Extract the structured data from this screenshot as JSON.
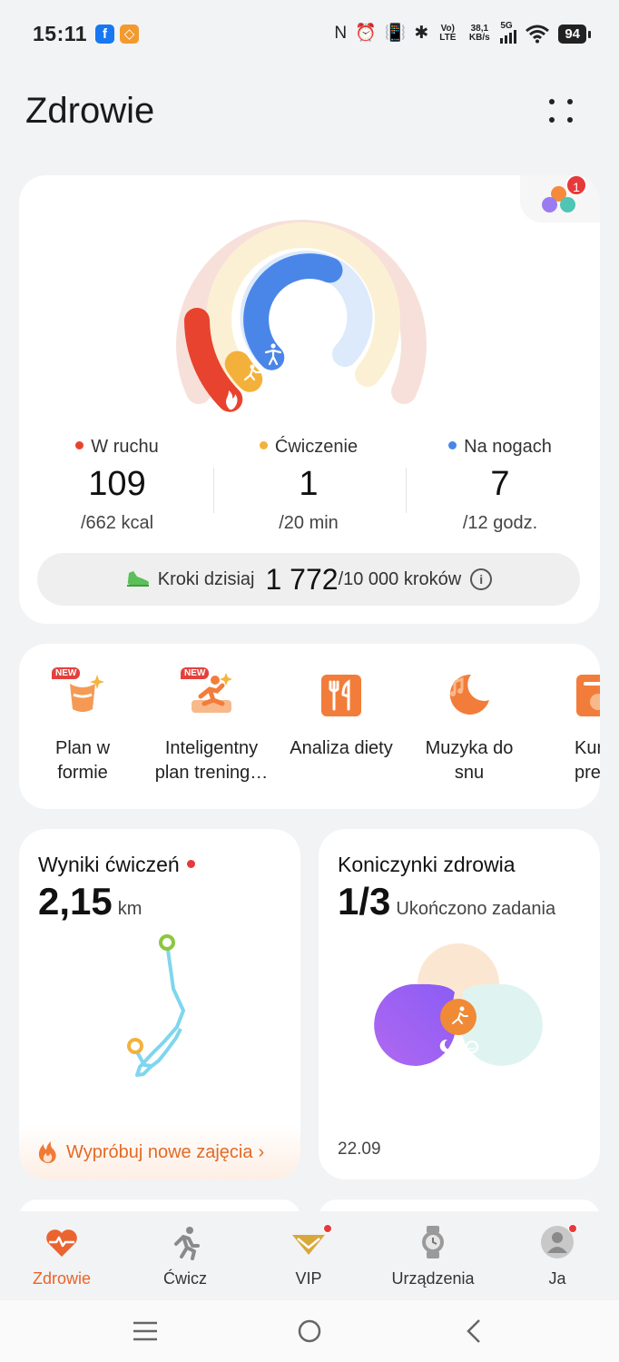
{
  "status_bar": {
    "time": "15:11",
    "volte": "Vo) LTE",
    "speed_value": "38,1",
    "speed_unit": "KB/s",
    "network": "5G",
    "battery": "94"
  },
  "header": {
    "title": "Zdrowie"
  },
  "activity": {
    "rings_badge_count": "1",
    "move": {
      "label": "W ruchu",
      "value": "109",
      "target": "/662 kcal",
      "color": "#e8432e",
      "progress": 0.165
    },
    "exercise": {
      "label": "Ćwiczenie",
      "value": "1",
      "target": "/20 min",
      "color": "#f3b13c",
      "progress": 0.05
    },
    "stand": {
      "label": "Na nogach",
      "value": "7",
      "target": "/12 godz.",
      "color": "#4a86e8",
      "progress": 0.583
    },
    "steps": {
      "label": "Kroki dzisiaj",
      "value": "1 772",
      "goal": "/10 000 kroków"
    }
  },
  "shortcuts": [
    {
      "line1": "Plan w",
      "line2": "formie",
      "new_badge": "NEW"
    },
    {
      "line1": "Inteligentny",
      "line2": "plan trening…",
      "new_badge": "NEW"
    },
    {
      "line1": "Analiza diety",
      "line2": ""
    },
    {
      "line1": "Muzyka do",
      "line2": "snu"
    },
    {
      "line1": "Kur",
      "line2": "prem"
    }
  ],
  "workout_card": {
    "title": "Wyniki ćwiczeń",
    "value": "2,15",
    "unit": "km",
    "cta": "Wypróbuj nowe zajęcia"
  },
  "clover_card": {
    "title": "Koniczynki zdrowia",
    "value": "1/3",
    "subtitle": "Ukończono zadania",
    "date": "22.09"
  },
  "bottom_nav": [
    {
      "label": "Zdrowie",
      "icon": "heart-pulse-icon",
      "active": true
    },
    {
      "label": "Ćwicz",
      "icon": "running-icon"
    },
    {
      "label": "VIP",
      "icon": "vip-icon"
    },
    {
      "label": "Urządzenia",
      "icon": "watch-icon"
    },
    {
      "label": "Ja",
      "icon": "avatar-icon"
    }
  ]
}
